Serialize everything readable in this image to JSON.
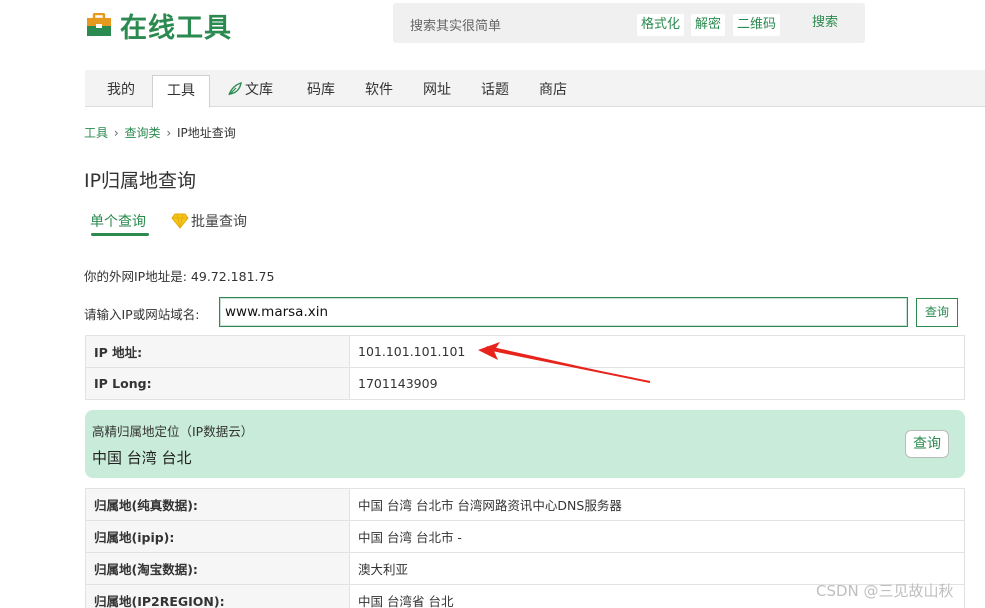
{
  "header": {
    "logo_text": "在线工具",
    "search_placeholder": "搜索其实很简单",
    "chips": [
      "格式化",
      "解密",
      "二维码"
    ],
    "search_button": "搜索"
  },
  "nav": {
    "items": [
      {
        "label": "我的"
      },
      {
        "label": "工具"
      },
      {
        "label": "文库"
      },
      {
        "label": "码库"
      },
      {
        "label": "软件"
      },
      {
        "label": "网址"
      },
      {
        "label": "话题"
      },
      {
        "label": "商店"
      }
    ],
    "active": "工具"
  },
  "breadcrumb": {
    "items": [
      "工具",
      "查询类",
      "IP地址查询"
    ],
    "separator": "›"
  },
  "page_title": "IP归属地查询",
  "tabs": {
    "single": "单个查询",
    "batch": "批量查询"
  },
  "my_ip": {
    "label": "你的外网IP地址是:",
    "value": "49.72.181.75"
  },
  "form": {
    "label": "请输入IP或网站域名:",
    "value": "www.marsa.xin",
    "button": "查询"
  },
  "basic_table": [
    {
      "key": "IP 地址:",
      "value": "101.101.101.101"
    },
    {
      "key": "IP Long:",
      "value": "1701143909"
    }
  ],
  "high_precision": {
    "title": "高精归属地定位（IP数据云）",
    "location": "中国 台湾 台北",
    "button": "查询"
  },
  "location_table": [
    {
      "key": "归属地(纯真数据):",
      "value": "中国 台湾 台北市 台湾网路资讯中心DNS服务器"
    },
    {
      "key": "归属地(ipip):",
      "value": "中国 台湾 台北市 -"
    },
    {
      "key": "归属地(淘宝数据):",
      "value": "澳大利亚"
    },
    {
      "key": "归属地(IP2REGION):",
      "value": "中国 台湾省 台北"
    }
  ],
  "watermark": "CSDN @三见故山秋",
  "colors": {
    "brand": "#2a8a4f",
    "highlight_bg": "#c9ebd9",
    "annotation_arrow": "#e8231c"
  }
}
